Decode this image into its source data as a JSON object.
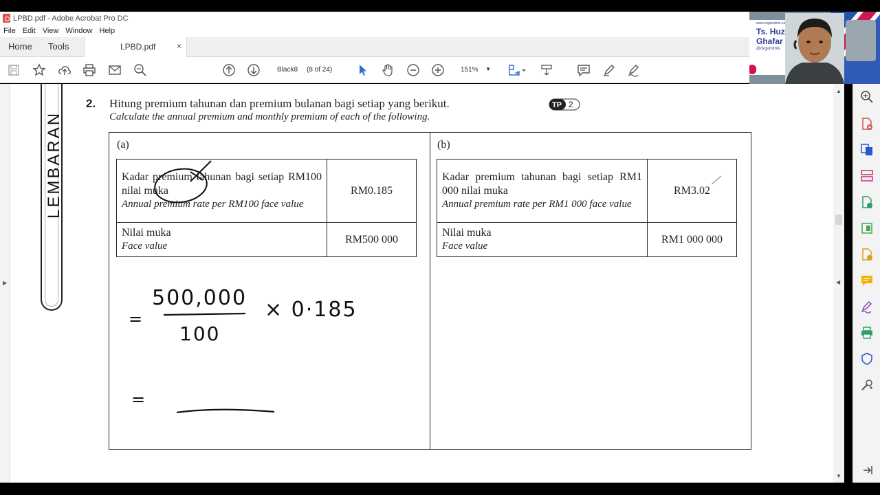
{
  "window": {
    "title": "LPBD.pdf - Adobe Acrobat Pro DC"
  },
  "menu": [
    "File",
    "Edit",
    "View",
    "Window",
    "Help"
  ],
  "tabs": {
    "home": "Home",
    "tools": "Tools",
    "document": "LPBD.pdf",
    "close": "×"
  },
  "toolbar": {
    "page_label": "Black8",
    "page_count": "(8 of 24)",
    "zoom": "151%"
  },
  "webcam": {
    "title1": "Ts. Huzai",
    "title2": "Ghafar",
    "handle": "@ckgumimis",
    "top": "www.ckgumimis.com"
  },
  "document": {
    "side_label": "LEMBARAN",
    "question_number": "2.",
    "question_my": "Hitung premium tahunan dan premium bulanan bagi setiap yang berikut.",
    "question_en": "Calculate the annual premium and monthly premium of each of the following.",
    "badge": {
      "tp": "TP",
      "level": "2"
    },
    "part_a": {
      "label": "(a)",
      "rate_my": "Kadar premium tahunan bagi setiap RM100 nilai muka",
      "rate_en": "Annual premium rate per RM100 face value",
      "rate_value": "RM0.185",
      "face_my": "Nilai muka",
      "face_en": "Face value",
      "face_value": "RM500 000"
    },
    "part_b": {
      "label": "(b)",
      "rate_my": "Kadar premium tahunan bagi setiap RM1 000 nilai muka",
      "rate_en": "Annual premium rate per RM1 000 face value",
      "rate_value": "RM3.02",
      "face_my": "Nilai muka",
      "face_en": "Face value",
      "face_value": "RM1 000 000"
    },
    "handwriting": {
      "eq1": "=",
      "numerator": "500,000",
      "denominator": "100",
      "multiplier": "× 0·185",
      "eq2": "="
    }
  }
}
